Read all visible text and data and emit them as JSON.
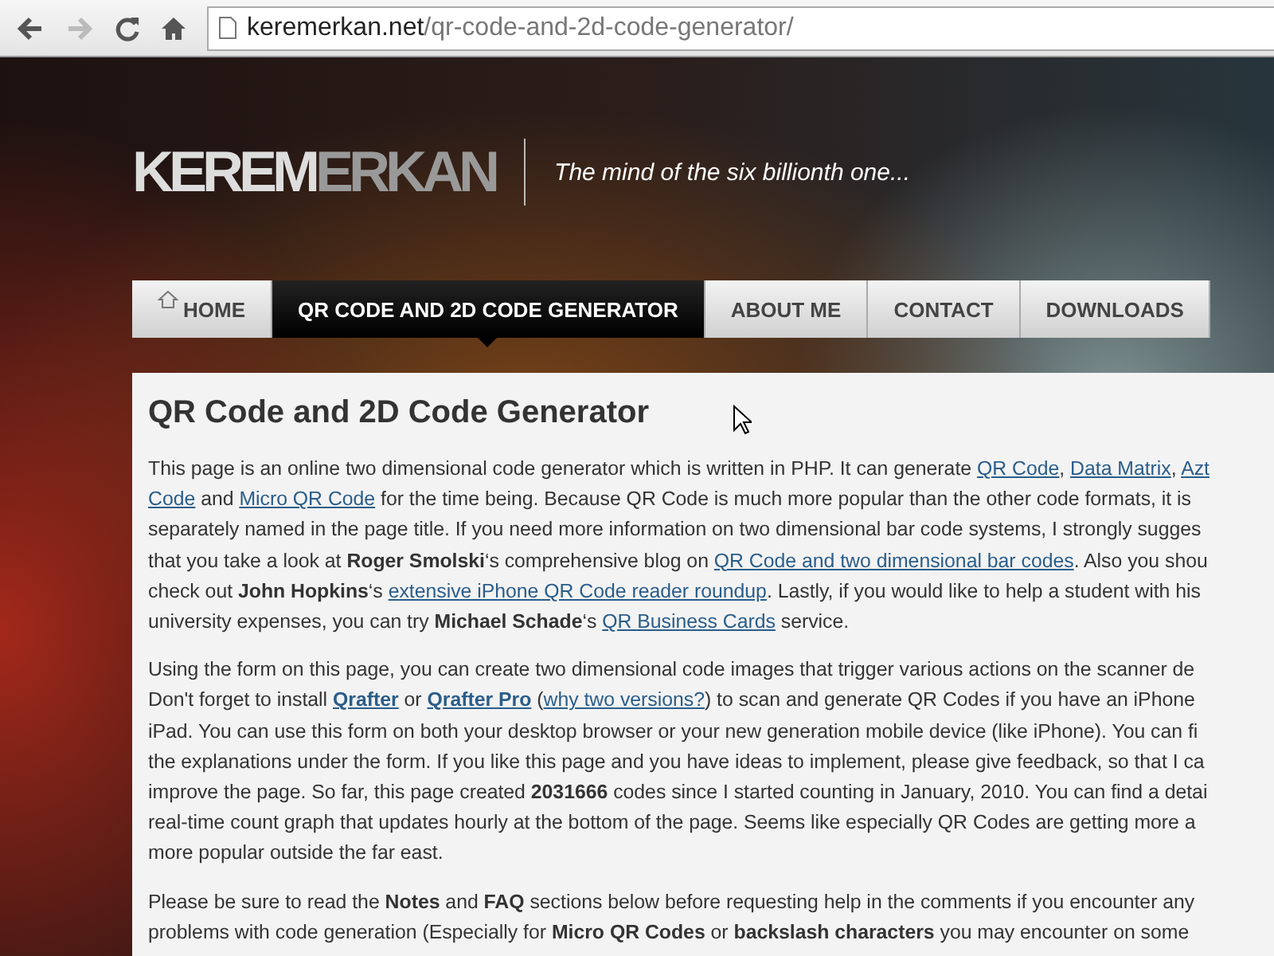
{
  "browser": {
    "url_host": "keremerkan.net",
    "url_path": "/qr-code-and-2d-code-generator/"
  },
  "site": {
    "logo_first": "KEREM",
    "logo_second": "ERKAN",
    "tagline": "The mind of the six billionth one..."
  },
  "nav": [
    {
      "label": "HOME",
      "kind": "home",
      "selected": false
    },
    {
      "label": "QR CODE AND 2D CODE GENERATOR",
      "kind": "page",
      "selected": true
    },
    {
      "label": "ABOUT ME",
      "kind": "page",
      "selected": false
    },
    {
      "label": "CONTACT",
      "kind": "page",
      "selected": false
    },
    {
      "label": "DOWNLOADS",
      "kind": "page",
      "selected": false
    }
  ],
  "heading": "QR Code and 2D Code Generator",
  "paragraphs": [
    {
      "lines": [
        [
          {
            "kind": "text",
            "text": "This page is an online two dimensional code generator which is written in PHP. It can generate "
          },
          {
            "kind": "link",
            "text": "QR Code"
          },
          {
            "kind": "text",
            "text": ", "
          },
          {
            "kind": "link",
            "text": "Data Matrix"
          },
          {
            "kind": "text",
            "text": ", "
          },
          {
            "kind": "link",
            "text": "Azt"
          }
        ],
        [
          {
            "kind": "link",
            "text": "Code"
          },
          {
            "kind": "text",
            "text": " and "
          },
          {
            "kind": "link",
            "text": "Micro QR Code"
          },
          {
            "kind": "text",
            "text": " for the time being. Because QR Code is much more popular than the other code formats, it is"
          }
        ],
        [
          {
            "kind": "text",
            "text": "separately named in the page title. If you need more information on two dimensional bar code systems, I strongly sugges"
          }
        ],
        [
          {
            "kind": "text",
            "text": "that you take a look at **Roger Smolski**‘s comprehensive blog on "
          },
          {
            "kind": "link",
            "text": "QR Code and two dimensional bar codes"
          },
          {
            "kind": "text",
            "text": ". Also you shou"
          }
        ],
        [
          {
            "kind": "text",
            "text": "check out **John Hopkins**‘s "
          },
          {
            "kind": "link",
            "text": "extensive iPhone QR Code reader roundup"
          },
          {
            "kind": "text",
            "text": ". Lastly, if you would like to help a student with his"
          }
        ],
        [
          {
            "kind": "text",
            "text": "university expenses, you can try **Michael Schade**‘s "
          },
          {
            "kind": "link",
            "text": "QR Business Cards"
          },
          {
            "kind": "text",
            "text": " service."
          }
        ]
      ]
    },
    {
      "lines": [
        [
          {
            "kind": "text",
            "text": "Using the form on this page, you can create two dimensional code images that trigger various actions on the scanner de"
          }
        ],
        [
          {
            "kind": "text",
            "text": "Don't forget to install "
          },
          {
            "kind": "strong-link",
            "text": "Qrafter"
          },
          {
            "kind": "text",
            "text": " or "
          },
          {
            "kind": "strong-link",
            "text": "Qrafter Pro"
          },
          {
            "kind": "text",
            "text": " ("
          },
          {
            "kind": "link",
            "text": "why two versions?"
          },
          {
            "kind": "text",
            "text": ") to scan and generate QR Codes if you have an iPhone"
          }
        ],
        [
          {
            "kind": "text",
            "text": "iPad. You can use this form on both your desktop browser or your new generation mobile device (like iPhone). You can fi"
          }
        ],
        [
          {
            "kind": "text",
            "text": "the explanations under the form. If you like this page and you have ideas to implement, please give feedback, so that I ca"
          }
        ],
        [
          {
            "kind": "text",
            "text": "improve the page. So far, this page created **2031666** codes since I started counting in January, 2010. You can find a detai"
          }
        ],
        [
          {
            "kind": "text",
            "text": "real-time count graph that updates hourly at the bottom of the page. Seems like especially QR Codes are getting more a"
          }
        ],
        [
          {
            "kind": "text",
            "text": "more popular outside the far east."
          }
        ]
      ]
    },
    {
      "lines": [
        [
          {
            "kind": "text",
            "text": "Please be sure to read the **Notes** and **FAQ** sections below before requesting help in the comments if you encounter any"
          }
        ],
        [
          {
            "kind": "text",
            "text": "problems with code generation (Especially for **Micro QR Codes** or **backslash characters** you may encounter on some"
          }
        ]
      ]
    }
  ]
}
